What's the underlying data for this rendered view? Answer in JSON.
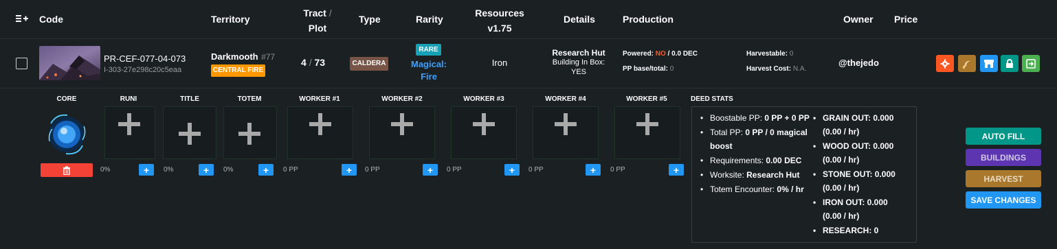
{
  "header": {
    "code": "Code",
    "territory": "Territory",
    "tract_line1": "Tract",
    "tract_sep": "/",
    "tract_line2": "Plot",
    "type": "Type",
    "rarity": "Rarity",
    "resources_line1": "Resources",
    "resources_line2": "v1.75",
    "details": "Details",
    "production": "Production",
    "owner": "Owner",
    "price": "Price"
  },
  "row": {
    "code": "PR-CEF-077-04-073",
    "sub_id": "I-303-27e298c20c5eaa",
    "territory_name": "Darkmooth",
    "territory_num": "#77",
    "territory_badge": "CENTRAL FIRE",
    "tract": "4",
    "plot_sep": "/",
    "plot": "73",
    "type_badge": "CALDERA",
    "rarity_badge": "RARE",
    "magical_line1": "Magical:",
    "magical_line2": "Fire",
    "resource": "Iron",
    "details_title": "Research Hut",
    "details_line2": "Building In Box:",
    "details_line3": "YES",
    "powered_label": "Powered:",
    "powered_value": "NO",
    "powered_sep": "/",
    "powered_dec": "0.0 DEC",
    "pp_label": "PP base/total:",
    "pp_value": "0",
    "harvestable_label": "Harvestable:",
    "harvestable_value": "0",
    "harvest_cost_label": "Harvest Cost:",
    "harvest_cost_value": "N.A.",
    "owner": "@thejedo"
  },
  "slots": [
    {
      "label": "CORE",
      "value": "0%"
    },
    {
      "label": "RUNI",
      "value": "0%"
    },
    {
      "label": "TITLE",
      "value": "0%"
    },
    {
      "label": "TOTEM",
      "value": "0 PP"
    },
    {
      "label": "WORKER #1",
      "value": "0 PP"
    },
    {
      "label": "WORKER #2",
      "value": "0 PP"
    },
    {
      "label": "WORKER #3",
      "value": "0 PP"
    },
    {
      "label": "WORKER #4",
      "value": "0 PP"
    },
    {
      "label": "WORKER #5",
      "value": ""
    }
  ],
  "deed_stats": {
    "title": "DEED STATS",
    "left": [
      {
        "label": "Boostable PP: ",
        "value": "0 PP + 0 PP"
      },
      {
        "label": "Total PP: ",
        "value": "0 PP / 0 magical boost"
      },
      {
        "label": "Requirements: ",
        "value": "0.00 DEC"
      },
      {
        "label": "Worksite: ",
        "value": "Research Hut"
      },
      {
        "label": "Totem Encounter: ",
        "value": "0% / hr"
      }
    ],
    "right": [
      {
        "label": "GRAIN OUT: ",
        "value": "0.000",
        "sub": "(0.00 / hr)"
      },
      {
        "label": "WOOD OUT: ",
        "value": "0.000",
        "sub": "(0.00 / hr)"
      },
      {
        "label": "STONE OUT: ",
        "value": "0.000",
        "sub": "(0.00 / hr)"
      },
      {
        "label": "IRON OUT: ",
        "value": "0.000",
        "sub": "(0.00 / hr)"
      },
      {
        "label": "RESEARCH: ",
        "value": "0",
        "sub": ""
      }
    ]
  },
  "buttons": {
    "auto_fill": "AUTO FILL",
    "buildings": "BUILDINGS",
    "harvest": "HARVEST",
    "save_changes": "SAVE CHANGES"
  },
  "colors": {
    "background": "#1b2023",
    "territory_badge": "#ff9800",
    "type_badge": "#795548",
    "rarity_badge": "#17a2b8",
    "magical": "#3aa0ff",
    "powered_no": "#ff5722",
    "auto_fill": "#009688",
    "buildings": "#5e35b1",
    "harvest": "#a9782c",
    "save_changes": "#2196f3",
    "delete": "#f44336"
  },
  "icons": [
    "menu-plus-icon",
    "gear-icon",
    "sickle-icon",
    "store-icon",
    "lock-icon",
    "exit-icon",
    "trash-icon",
    "plus-icon"
  ]
}
